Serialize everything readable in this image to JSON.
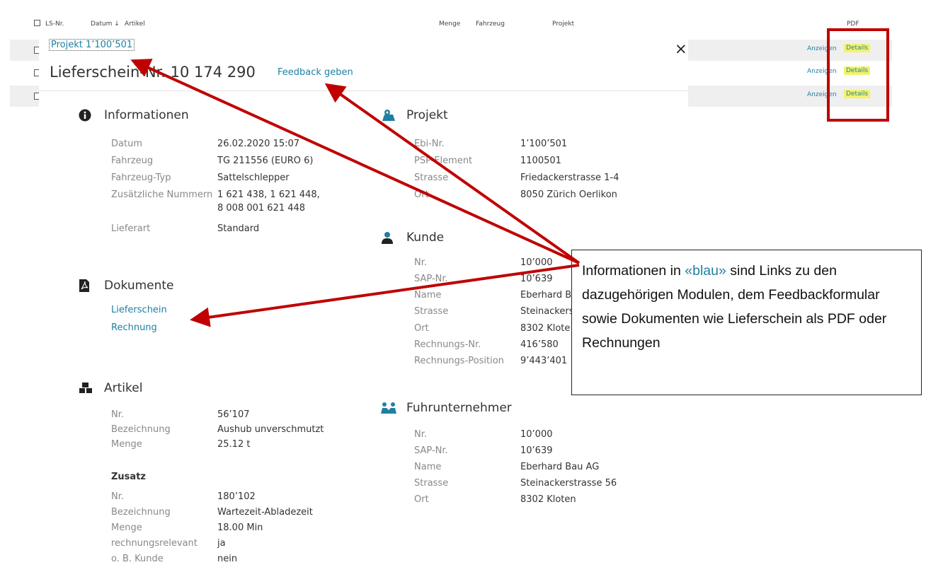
{
  "background_table": {
    "headers": [
      "LS-Nr.",
      "Datum ↓",
      "Artikel",
      "Menge",
      "Fahrzeug",
      "Projekt",
      "PDF"
    ],
    "rows": [
      {
        "anzeigen": "Anzeigen",
        "details": "Details"
      },
      {
        "anzeigen": "Anzeigen",
        "details": "Details"
      },
      {
        "anzeigen": "Anzeigen",
        "details": "Details"
      }
    ]
  },
  "modal": {
    "project_link": "Projekt 1’100’501",
    "title": "Lieferschein-Nr. 10 174 290",
    "feedback_link": "Feedback geben",
    "close": "×"
  },
  "informationen": {
    "heading": "Informationen",
    "fields": [
      {
        "label": "Datum",
        "value": "26.02.2020 15:07"
      },
      {
        "label": "Fahrzeug",
        "value": "TG 211556 (EURO 6)"
      },
      {
        "label": "Fahrzeug-Typ",
        "value": "Sattelschlepper"
      },
      {
        "label": "Zusätzliche Nummern",
        "value": "1 621 438, 1 621 448,",
        "value2": "8 008 001 621 448"
      },
      {
        "label": "Lieferart",
        "value": "Standard"
      }
    ]
  },
  "dokumente": {
    "heading": "Dokumente",
    "links": [
      "Lieferschein",
      "Rechnung"
    ]
  },
  "artikel": {
    "heading": "Artikel",
    "fields": [
      {
        "label": "Nr.",
        "value": "56’107"
      },
      {
        "label": "Bezeichnung",
        "value": "Aushub unverschmutzt"
      },
      {
        "label": "Menge",
        "value": "25.12 t"
      }
    ],
    "zusatz_heading": "Zusatz",
    "zusatz": [
      {
        "label": "Nr.",
        "value": "180’102"
      },
      {
        "label": "Bezeichnung",
        "value": "Wartezeit-Abladezeit"
      },
      {
        "label": "Menge",
        "value": "18.00 Min"
      },
      {
        "label": "rechnungsrelevant",
        "value": "ja"
      },
      {
        "label": "o. B. Kunde",
        "value": "nein"
      }
    ]
  },
  "projekt": {
    "heading": "Projekt",
    "fields": [
      {
        "label": "Ebi-Nr.",
        "value": "1’100’501"
      },
      {
        "label": "PSP-Element",
        "value": "1100501"
      },
      {
        "label": "Strasse",
        "value": "Friedackerstrasse 1-4"
      },
      {
        "label": "Ort",
        "value": "8050 Zürich Oerlikon"
      }
    ]
  },
  "kunde": {
    "heading": "Kunde",
    "fields": [
      {
        "label": "Nr.",
        "value": "10’000"
      },
      {
        "label": "SAP-Nr.",
        "value": "10’639"
      },
      {
        "label": "Name",
        "value": "Eberhard B"
      },
      {
        "label": "Strasse",
        "value": "Steinackers"
      },
      {
        "label": "Ort",
        "value": "8302 Klote"
      },
      {
        "label": "Rechnungs-Nr.",
        "value": "416’580"
      },
      {
        "label": "Rechnungs-Position",
        "value": "9’443’401"
      }
    ]
  },
  "fuhrunternehmer": {
    "heading": "Fuhrunternehmer",
    "fields": [
      {
        "label": "Nr.",
        "value": "10’000"
      },
      {
        "label": "SAP-Nr.",
        "value": "10’639"
      },
      {
        "label": "Name",
        "value": "Eberhard Bau AG"
      },
      {
        "label": "Strasse",
        "value": "Steinackerstrasse 56"
      },
      {
        "label": "Ort",
        "value": "8302 Kloten"
      }
    ]
  },
  "callout": {
    "pre": "Informationen in ",
    "blau": "«blau»",
    "post": " sind Links zu den dazugehörigen Modulen, dem Feedbackformular sowie Dokumenten wie Lieferschein als PDF oder Rechnungen"
  },
  "colors": {
    "link": "#1f7fa2",
    "annotation": "#c00000",
    "highlight": "#f3f36a"
  }
}
